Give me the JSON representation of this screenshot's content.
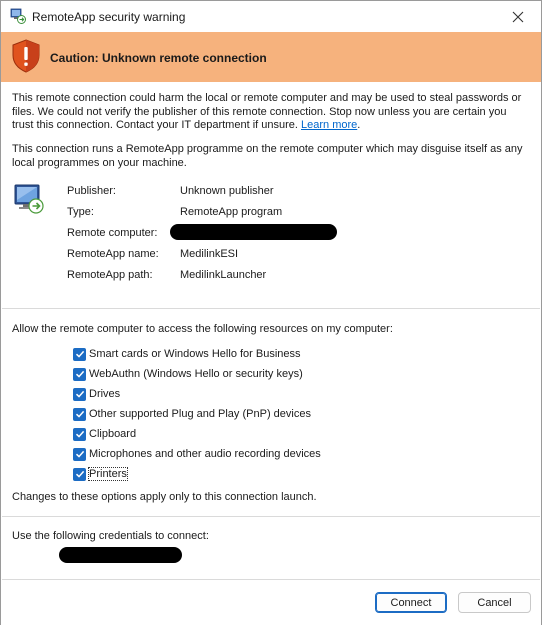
{
  "window": {
    "title": "RemoteApp security warning"
  },
  "banner": {
    "title": "Caution: Unknown remote connection",
    "color": "#f6b27d"
  },
  "warning": {
    "line1": "This remote connection could harm the local or remote computer and may be used to steal passwords or",
    "line2": "files. We could not verify the publisher of this remote connection. Stop now unless you are certain you",
    "line3_prefix": "trust this connection. Contact your IT department if unsure. ",
    "learn_more": "Learn more",
    "line3_suffix": "."
  },
  "info": {
    "line1": "This connection runs a RemoteApp programme on the remote computer which may disguise itself as any",
    "line2": "local programmes on your machine."
  },
  "details": [
    {
      "label": "Publisher:",
      "value": "Unknown publisher"
    },
    {
      "label": "Type:",
      "value": "RemoteApp program"
    },
    {
      "label": "Remote computer:",
      "value": ""
    },
    {
      "label": "RemoteApp name:",
      "value": "MedilinkESI"
    },
    {
      "label": "RemoteApp path:",
      "value": "MedilinkLauncher"
    }
  ],
  "resources": {
    "heading": "Allow the remote computer to access the following resources on my computer:",
    "items": [
      {
        "label": "Smart cards or Windows Hello for Business",
        "checked": true
      },
      {
        "label": "WebAuthn (Windows Hello or security keys)",
        "checked": true
      },
      {
        "label": "Drives",
        "checked": true
      },
      {
        "label": "Other supported Plug and Play (PnP) devices",
        "checked": true
      },
      {
        "label": "Clipboard",
        "checked": true
      },
      {
        "label": "Microphones and other audio recording devices",
        "checked": true
      },
      {
        "label": "Printers",
        "checked": true
      }
    ],
    "note": "Changes to these options apply only to this connection launch."
  },
  "credentials": {
    "heading": "Use the following credentials to connect:"
  },
  "buttons": {
    "connect": "Connect",
    "cancel": "Cancel"
  },
  "colors": {
    "accent": "#1c6cc4",
    "link": "#0066cc"
  },
  "icons": {
    "title": "remoteapp-icon",
    "banner": "warning-shield-icon",
    "details": "remote-computer-icon",
    "close": "close-icon",
    "checkbox": "checkmark-icon"
  }
}
